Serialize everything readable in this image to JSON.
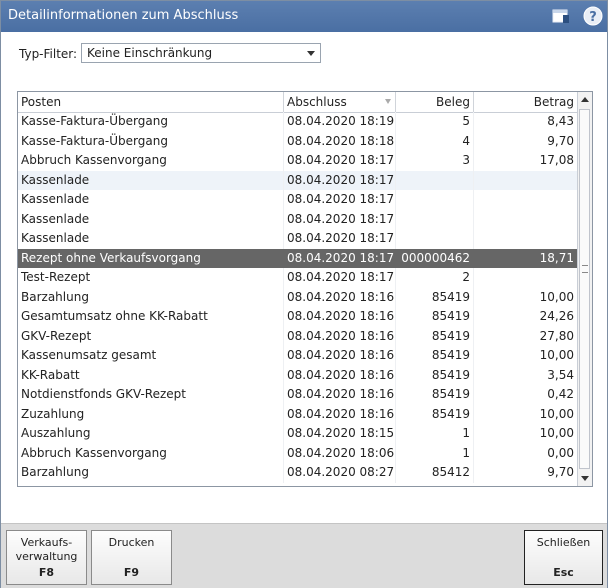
{
  "window": {
    "title": "Detailinformationen zum Abschluss",
    "icons": [
      "window-icon",
      "help-icon"
    ]
  },
  "filter": {
    "label": "Typ-Filter:",
    "selected": "Keine Einschränkung"
  },
  "table": {
    "columns": [
      "Posten",
      "Abschluss",
      "Beleg",
      "Betrag"
    ],
    "sorted_column": "Abschluss",
    "rows": [
      {
        "posten": "Kasse-Faktura-Übergang",
        "abschluss": "08.04.2020 18:19",
        "beleg": "5",
        "betrag": "8,43"
      },
      {
        "posten": "Kasse-Faktura-Übergang",
        "abschluss": "08.04.2020 18:18",
        "beleg": "4",
        "betrag": "9,70"
      },
      {
        "posten": "Abbruch Kassenvorgang",
        "abschluss": "08.04.2020 18:17",
        "beleg": "3",
        "betrag": "17,08"
      },
      {
        "posten": "Kassenlade",
        "abschluss": "08.04.2020 18:17",
        "beleg": "",
        "betrag": ""
      },
      {
        "posten": "Kassenlade",
        "abschluss": "08.04.2020 18:17",
        "beleg": "",
        "betrag": ""
      },
      {
        "posten": "Kassenlade",
        "abschluss": "08.04.2020 18:17",
        "beleg": "",
        "betrag": ""
      },
      {
        "posten": "Kassenlade",
        "abschluss": "08.04.2020 18:17",
        "beleg": "",
        "betrag": ""
      },
      {
        "posten": "Rezept ohne Verkaufsvorgang",
        "abschluss": "08.04.2020 18:17",
        "beleg": "000000462",
        "betrag": "18,71"
      },
      {
        "posten": "Test-Rezept",
        "abschluss": "08.04.2020 18:17",
        "beleg": "2",
        "betrag": ""
      },
      {
        "posten": "Barzahlung",
        "abschluss": "08.04.2020 18:16",
        "beleg": "85419",
        "betrag": "10,00"
      },
      {
        "posten": "Gesamtumsatz ohne KK-Rabatt",
        "abschluss": "08.04.2020 18:16",
        "beleg": "85419",
        "betrag": "24,26"
      },
      {
        "posten": "GKV-Rezept",
        "abschluss": "08.04.2020 18:16",
        "beleg": "85419",
        "betrag": "27,80"
      },
      {
        "posten": "Kassenumsatz gesamt",
        "abschluss": "08.04.2020 18:16",
        "beleg": "85419",
        "betrag": "10,00"
      },
      {
        "posten": "KK-Rabatt",
        "abschluss": "08.04.2020 18:16",
        "beleg": "85419",
        "betrag": "3,54"
      },
      {
        "posten": "Notdienstfonds GKV-Rezept",
        "abschluss": "08.04.2020 18:16",
        "beleg": "85419",
        "betrag": "0,42"
      },
      {
        "posten": "Zuzahlung",
        "abschluss": "08.04.2020 18:16",
        "beleg": "85419",
        "betrag": "10,00"
      },
      {
        "posten": "Auszahlung",
        "abschluss": "08.04.2020 18:15",
        "beleg": "1",
        "betrag": "10,00"
      },
      {
        "posten": "Abbruch Kassenvorgang",
        "abschluss": "08.04.2020 18:06",
        "beleg": "1",
        "betrag": "0,00"
      },
      {
        "posten": "Barzahlung",
        "abschluss": "08.04.2020 08:27",
        "beleg": "85412",
        "betrag": "9,70"
      }
    ],
    "selected_index": 7,
    "hover_index": 3
  },
  "footer": {
    "verkauf": {
      "line1": "Verkaufs-",
      "line2": "verwaltung",
      "key": "F8"
    },
    "drucken": {
      "label": "Drucken",
      "key": "F9"
    },
    "schliessen": {
      "label": "Schließen",
      "key": "Esc"
    }
  },
  "colors": {
    "titlebar": "#4a6fa3",
    "selected_row": "#666666",
    "hover_row": "#eef3f9",
    "footer": "#dcdcdc"
  }
}
